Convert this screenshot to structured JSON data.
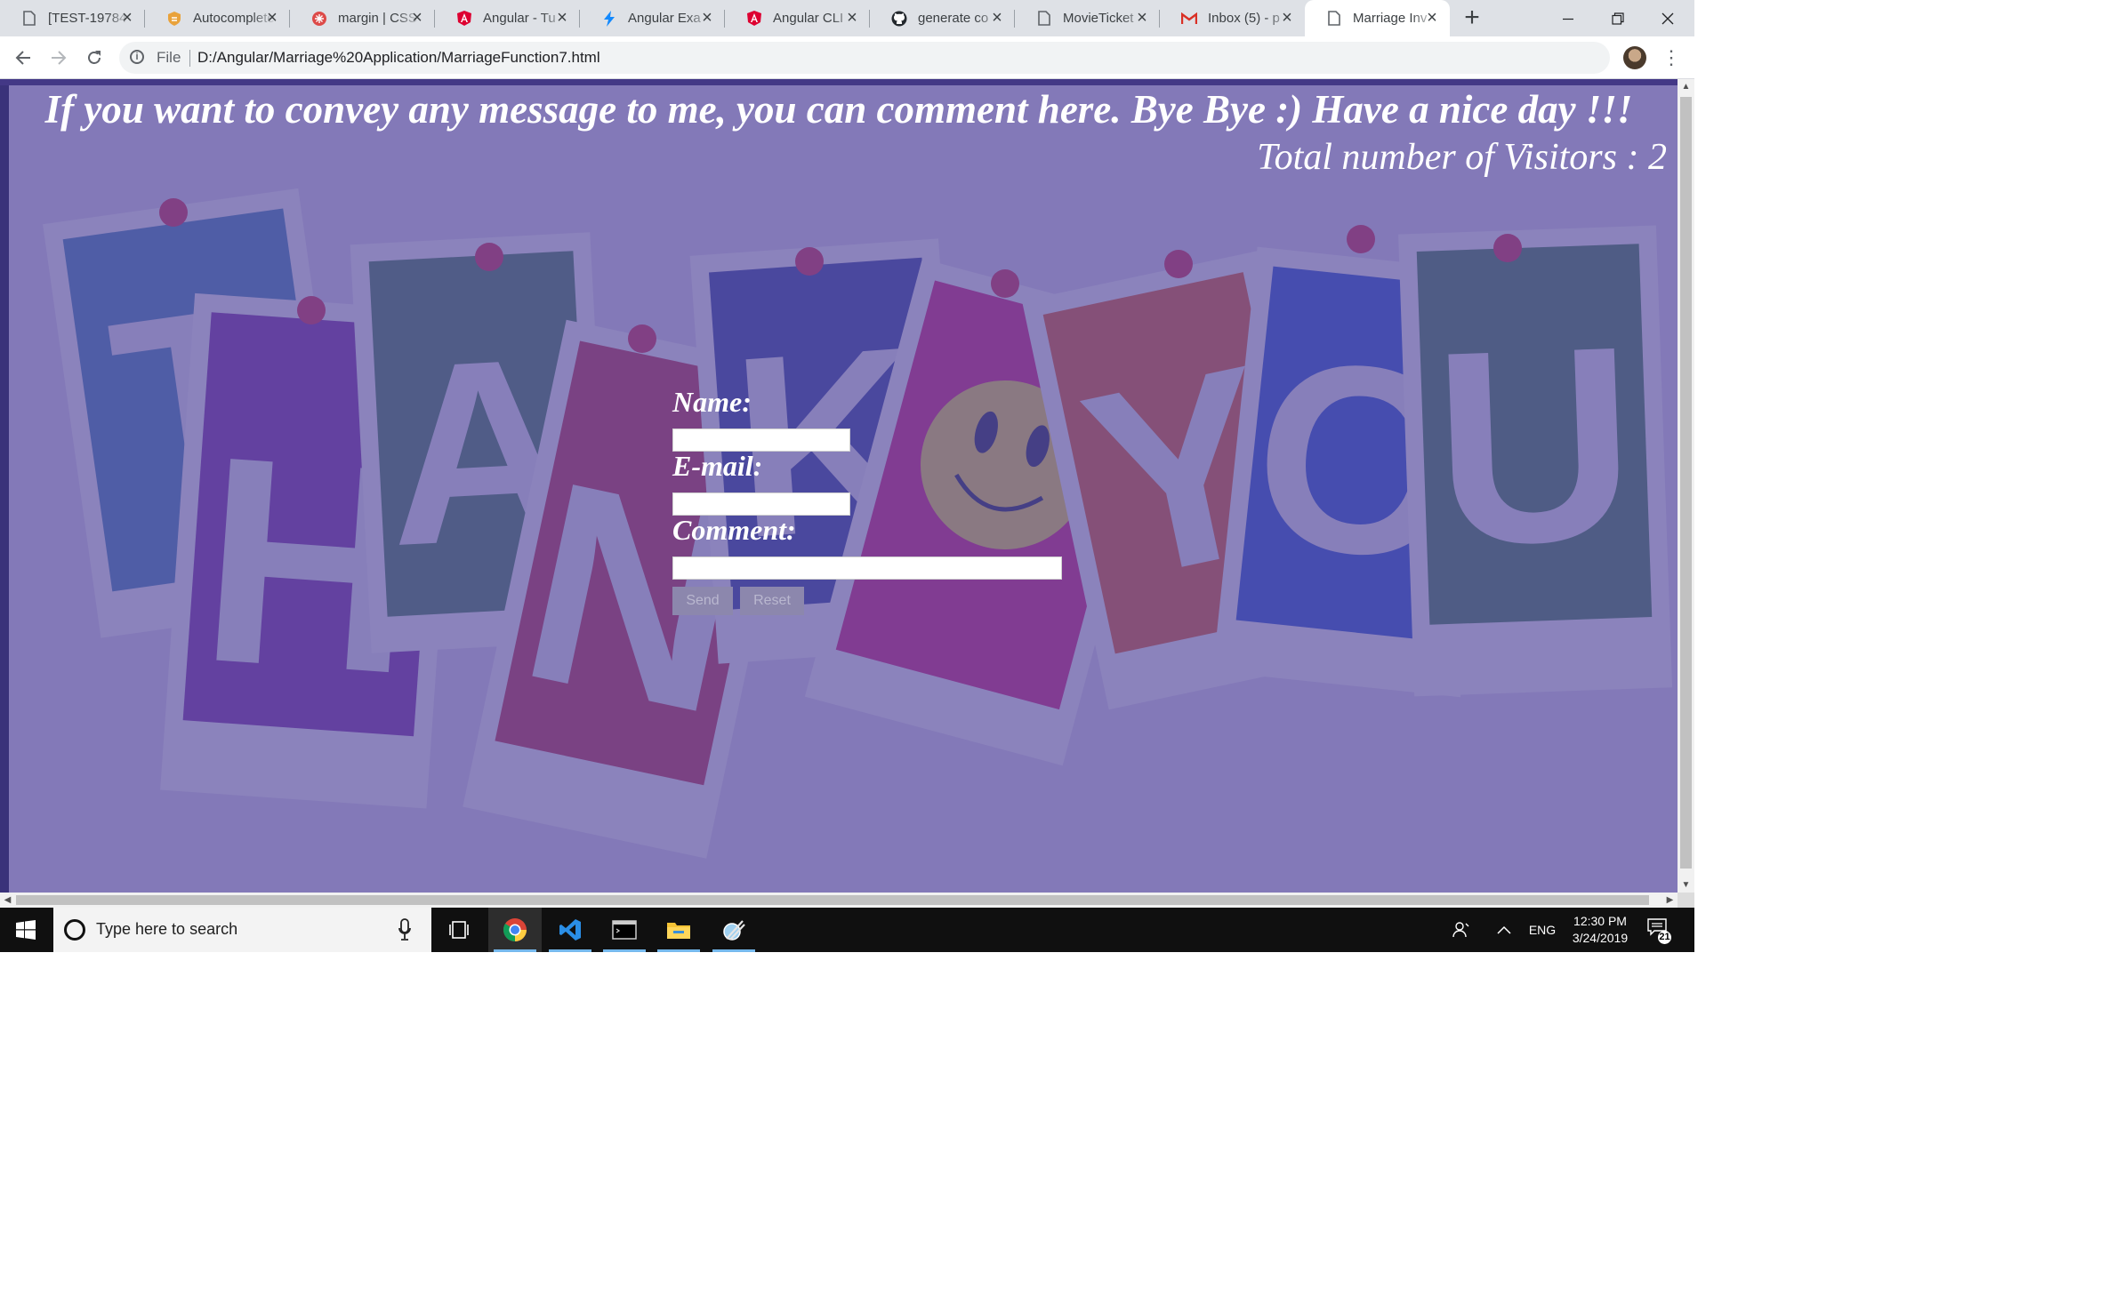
{
  "browser": {
    "tabs": [
      {
        "label": "[TEST-19784",
        "icon": "page-icon"
      },
      {
        "label": "Autocomplete",
        "icon": "shield-icon"
      },
      {
        "label": "margin | CSS",
        "icon": "css-icon"
      },
      {
        "label": "Angular - Tu",
        "icon": "angular-icon"
      },
      {
        "label": "Angular Exa",
        "icon": "stackblitz-icon"
      },
      {
        "label": "Angular CLI",
        "icon": "angular-icon"
      },
      {
        "label": "generate co",
        "icon": "github-icon"
      },
      {
        "label": "MovieTicket",
        "icon": "page-icon"
      },
      {
        "label": "Inbox (5) - p",
        "icon": "gmail-icon"
      },
      {
        "label": "Marriage Inv",
        "icon": "page-icon",
        "active": true
      }
    ],
    "address": {
      "scheme_label": "File",
      "url": "D:/Angular/Marriage%20Application/MarriageFunction7.html"
    }
  },
  "page": {
    "headline": "If you want to convey any message to me, you can comment here. Bye Bye :) Have a nice day !!!",
    "visitors_label": "Total number of Visitors : 2",
    "form": {
      "name_label": "Name:",
      "email_label": "E-mail:",
      "comment_label": "Comment:",
      "name_value": "",
      "email_value": "",
      "comment_value": "",
      "send_label": "Send",
      "reset_label": "Reset"
    },
    "background": {
      "overlay_color": "#584c9e",
      "letters": [
        "T",
        "H",
        "A",
        "N",
        "K",
        "Y",
        "O",
        "U"
      ]
    }
  },
  "taskbar": {
    "search_placeholder": "Type here to search",
    "language": "ENG",
    "time": "12:30 PM",
    "date": "3/24/2019",
    "notifications_count": "21"
  }
}
